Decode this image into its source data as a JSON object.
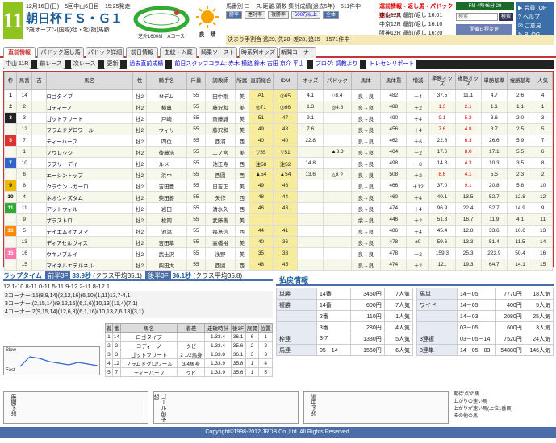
{
  "header": {
    "race_number": "11",
    "date": "12月16日(日)　5回中山6日目　15:25発走",
    "race_name": "朝日杯ＦＳ・Ｇ１",
    "condition": "2歳オープン(国際)牡・牝(指)馬齢",
    "course_label": "芝外1600M　Aコース",
    "weather_label": "良　晴",
    "stats_title": "馬番別 コース.距離.頭数 集計成績(過去5年)　511件中",
    "stats_tabs": [
      "勝率",
      "連対率",
      "複勝率"
    ],
    "stats_link": "500万以上",
    "stats_link2": "全体",
    "quick_links": [
      {
        "name": "運前情報・返し馬・パドック速レース",
        "time": ""
      },
      {
        "name": "中山12R",
        "extra": "運前/返し",
        "time": "16:01"
      },
      {
        "name": "中京12R",
        "extra": "運前/返し",
        "time": "16:10"
      },
      {
        "name": "阪神12R",
        "extra": "運前/返し",
        "time": "16:20"
      }
    ],
    "fm_time": "FM 4時46分 29",
    "search_placeholder": "検索",
    "search_button": "検索",
    "history_button": "開催日程変更",
    "side_menu": [
      "会員TOP",
      "ヘルプ",
      "ご意見",
      "BLOG"
    ],
    "info_bar": "決まり手割合 逃29, 先28, 差28, 追15　1571件中"
  },
  "tabs": [
    "直前情報",
    "パドック返し馬",
    "パドック詳細",
    "前日情報",
    "血統・入厩",
    "騎乗ソースト",
    "時系列オッズ",
    "新聞コーナー"
  ],
  "toolbar": {
    "race_select": "中山 11R",
    "prev": "前レース",
    "next": "次レース",
    "update": "更新",
    "links": [
      "過去直前成績",
      "前日スタッフコラム: 赤木 横路 鈴木 吉田 京介 平山",
      "ブログ: 調教より",
      "トレセンリポート"
    ]
  },
  "columns": [
    "枠",
    "馬番",
    "吉",
    "馬名",
    "性",
    "騎手名",
    "斤量",
    "調教師",
    "所属",
    "直前総合",
    "IDM",
    "オッズ",
    "パドック",
    "馬体",
    "馬体重",
    "増減",
    "単勝オッズ",
    "複勝オッズ",
    "単勝基準",
    "複勝基準",
    "人気"
  ],
  "rows": [
    {
      "waku": "1",
      "ban": "14",
      "name": "ロゴタイプ",
      "sex": "牡2",
      "jockey": "Mデム",
      "kin": "55",
      "trainer": "田中剛",
      "aff": "美",
      "sogo": "A1",
      "idm": "◎65",
      "odds": "4.1",
      "pad": "○8.4",
      "body": "良→良",
      "weight": "482",
      "diff": "－4",
      "tan": "37.5",
      "fuku": "11.1",
      "kt": "4.7",
      "kf": "2.6",
      "pop": "4"
    },
    {
      "waku": "2",
      "ban": "2",
      "name": "コディーノ",
      "sex": "牡2",
      "jockey": "横典",
      "kin": "55",
      "trainer": "藤沢和",
      "aff": "美",
      "sogo": "◎71",
      "idm": "◎66",
      "odds": "1.3",
      "pad": "◎4.8",
      "body": "良→良",
      "weight": "488",
      "diff": "＋2",
      "tan": "1.3",
      "fuku": "2.1",
      "kt": "1.1",
      "kf": "1.1",
      "pop": "1"
    },
    {
      "waku": "3",
      "ban": "3",
      "name": "ゴットフリート",
      "sex": "牡2",
      "jockey": "戸崎",
      "kin": "55",
      "trainer": "斎藤誠",
      "aff": "美",
      "sogo": "51",
      "idm": "47",
      "odds": "9.1",
      "pad": "",
      "body": "良→良",
      "weight": "490",
      "diff": "＋4",
      "tan": "9.1",
      "fuku": "5.3",
      "kt": "3.6",
      "kf": "2.0",
      "pop": "3"
    },
    {
      "waku": "4",
      "ban": "12",
      "name": "フラムドグロワール",
      "sex": "牡2",
      "jockey": "ウィリ",
      "kin": "55",
      "trainer": "藤沢和",
      "aff": "美",
      "sogo": "49",
      "idm": "48",
      "odds": "7.6",
      "pad": "",
      "body": "良→良",
      "weight": "456",
      "diff": "＋4",
      "tan": "7.6",
      "fuku": "4.8",
      "kt": "3.7",
      "kf": "2.5",
      "pop": "5"
    },
    {
      "waku": "5",
      "ban": "7",
      "name": "ティーハーフ",
      "sex": "牡2",
      "jockey": "四位",
      "kin": "55",
      "trainer": "西浦",
      "aff": "西",
      "sogo": "40",
      "idm": "40",
      "odds": "22.8",
      "pad": "",
      "body": "良→良",
      "weight": "462",
      "diff": "＋6",
      "tan": "22.8",
      "fuku": "6.3",
      "kt": "26.6",
      "kf": "5.9",
      "pop": "7"
    },
    {
      "waku": "6",
      "ban": "1",
      "name": "ノウレッジ",
      "sex": "牡2",
      "jockey": "後藤浩",
      "kin": "55",
      "trainer": "二ノ宮",
      "aff": "美",
      "sogo": "▽55",
      "idm": "▽51",
      "odds": "",
      "pad": "▲3.8",
      "body": "良→良",
      "weight": "464",
      "diff": "－2",
      "tan": "17.6",
      "fuku": "8.0",
      "kt": "17.1",
      "kf": "5.5",
      "pop": "6"
    },
    {
      "waku": "7",
      "ban": "10",
      "name": "ラブリーデイ",
      "sex": "牡2",
      "jockey": "ルメー",
      "kin": "55",
      "trainer": "池江寿",
      "aff": "西",
      "sogo": "注58",
      "idm": "注52",
      "odds": "14.8",
      "pad": "",
      "body": "良→良",
      "weight": "498",
      "diff": "－8",
      "tan": "14.8",
      "fuku": "4.3",
      "kt": "10.3",
      "kf": "3.5",
      "pop": "8"
    },
    {
      "waku": "8",
      "ban": "6",
      "name": "エーシントップ",
      "sex": "牡2",
      "jockey": "浜中",
      "kin": "55",
      "trainer": "西園",
      "aff": "西",
      "sogo": "▲54",
      "idm": "▲54",
      "odds": "13.6",
      "pad": "△8.2",
      "body": "良→良",
      "weight": "508",
      "diff": "＋2",
      "tan": "8.6",
      "fuku": "4.1",
      "kt": "5.5",
      "kf": "2.3",
      "pop": "2"
    },
    {
      "waku": "9",
      "ban": "8",
      "name": "クラウンレガーロ",
      "sex": "牡2",
      "jockey": "吉田豊",
      "kin": "55",
      "trainer": "日吉正",
      "aff": "美",
      "sogo": "49",
      "idm": "46",
      "odds": "",
      "pad": "",
      "body": "良→良",
      "weight": "466",
      "diff": "＋12",
      "tan": "37.0",
      "fuku": "9.1",
      "kt": "20.8",
      "kf": "5.8",
      "pop": "10"
    },
    {
      "waku": "10",
      "ban": "4",
      "name": "ネオウィズダム",
      "sex": "牡2",
      "jockey": "柴田善",
      "kin": "55",
      "trainer": "矢作",
      "aff": "西",
      "sogo": "48",
      "idm": "44",
      "odds": "",
      "pad": "",
      "body": "良→良",
      "weight": "460",
      "diff": "＋4",
      "tan": "40.1",
      "fuku": "13.5",
      "kt": "52.7",
      "kf": "12.8",
      "pop": "12"
    },
    {
      "waku": "11",
      "ban": "11",
      "name": "アットウィル",
      "sex": "牡2",
      "jockey": "岩田",
      "kin": "55",
      "trainer": "清水久",
      "aff": "西",
      "sogo": "46",
      "idm": "43",
      "odds": "",
      "pad": "",
      "body": "良→良",
      "weight": "474",
      "diff": "＋4",
      "tan": "96.9",
      "fuku": "22.4",
      "kt": "52.7",
      "kf": "14.9",
      "pop": "9"
    },
    {
      "waku": "12",
      "ban": "9",
      "name": "ザラストロ",
      "sex": "牡2",
      "jockey": "松岡",
      "kin": "55",
      "trainer": "武藤善",
      "aff": "美",
      "sogo": "",
      "idm": "",
      "odds": "",
      "pad": "",
      "body": "余→良",
      "weight": "446",
      "diff": "＋2",
      "tan": "51.3",
      "fuku": "16.7",
      "kt": "11.9",
      "kf": "4.1",
      "pop": "11"
    },
    {
      "waku": "13",
      "ban": "5",
      "name": "テイエムイナズマ",
      "sex": "牡2",
      "jockey": "池添",
      "kin": "55",
      "trainer": "福島信",
      "aff": "西",
      "sogo": "44",
      "idm": "41",
      "odds": "",
      "pad": "",
      "body": "良→良",
      "weight": "486",
      "diff": "＋4",
      "tan": "45.4",
      "fuku": "12.8",
      "kt": "33.6",
      "kf": "10.6",
      "pop": "13"
    },
    {
      "waku": "14",
      "ban": "13",
      "name": "ディアセルヴィス",
      "sex": "牡2",
      "jockey": "吉田隼",
      "kin": "55",
      "trainer": "高橋裕",
      "aff": "美",
      "sogo": "40",
      "idm": "36",
      "odds": "",
      "pad": "",
      "body": "良→良",
      "weight": "478",
      "diff": "±0",
      "tan": "59.6",
      "fuku": "13.3",
      "kt": "51.4",
      "kf": "11.5",
      "pop": "14"
    },
    {
      "waku": "15",
      "ban": "16",
      "name": "ウキノプルイ",
      "sex": "牡2",
      "jockey": "武士沢",
      "kin": "55",
      "trainer": "浅野",
      "aff": "美",
      "sogo": "35",
      "idm": "33",
      "odds": "",
      "pad": "",
      "body": "良→良",
      "weight": "478",
      "diff": "－2",
      "tan": "159.3",
      "fuku": "25.3",
      "kt": "223.9",
      "kf": "50.4",
      "pop": "16"
    },
    {
      "waku": "16",
      "ban": "15",
      "name": "マイネルエテルネル",
      "sex": "牡2",
      "jockey": "柴田大",
      "kin": "55",
      "trainer": "西園",
      "aff": "西",
      "sogo": "48",
      "idm": "45",
      "odds": "",
      "pad": "",
      "body": "良→良",
      "weight": "474",
      "diff": "＋2",
      "tan": "121",
      "fuku": "19.3",
      "kt": "64.7",
      "kf": "14.1",
      "pop": "15"
    }
  ],
  "lap": {
    "title": "ラップタイム",
    "first_label": "前半3F",
    "first_val": "33.9秒",
    "first_avg": "(クラス平均35.1)",
    "last_label": "後半3F",
    "last_val": "36.1秒",
    "last_avg": "(クラス平均35.8)",
    "laps": "12.1-10.8-11.0-11.5-11.9-12.2-11.8-12.1",
    "corners": [
      "2コーナー:15(8,9,14)(2,12,16)(6,10)(1,11)13,7-4,1",
      "3コーナー:(2,15,14)(9,12,16)(6,1,6)(10,13)(11,4)(7,1)",
      "4コーナー:2(9,15,14)(12,6,8)(6,1,16)(10,13,7,6,13)(3,1)"
    ],
    "pace_label": "Slow",
    "pace_label2": "Fast"
  },
  "results": {
    "headers": [
      "着",
      "番",
      "馬名",
      "着差",
      "走破時計",
      "後3F",
      "展開",
      "位置"
    ],
    "rows": [
      [
        "1",
        "14",
        "ロゴタイプ",
        "",
        "1.33.4",
        "36.1",
        "6",
        "1"
      ],
      [
        "2",
        "2",
        "コディーノ",
        "クビ",
        "1.33.4",
        "35.6",
        "2",
        "2"
      ],
      [
        "3",
        "3",
        "ゴットフリート",
        "2 1/2馬身",
        "1.33.8",
        "36.1",
        "3",
        "3"
      ],
      [
        "4",
        "12",
        "フラムドグロワール",
        "3/4馬身",
        "1.33.9",
        "35.8",
        "1",
        "4"
      ],
      [
        "5",
        "7",
        "ティーハーフ",
        "クビ",
        "1.33.9",
        "35.6",
        "1",
        "5"
      ]
    ]
  },
  "payout": {
    "title": "払戻情報",
    "left": [
      {
        "label": "単勝",
        "combo": "14番",
        "amount": "3450円",
        "pop": "7人気"
      },
      {
        "label": "複勝",
        "combo": "14番",
        "amount": "600円",
        "pop": "7人気"
      },
      {
        "label": "",
        "combo": "2番",
        "amount": "110円",
        "pop": "1人気"
      },
      {
        "label": "",
        "combo": "3番",
        "amount": "280円",
        "pop": "4人気"
      },
      {
        "label": "枠連",
        "combo": "3-7",
        "amount": "1380円",
        "pop": "5人気"
      },
      {
        "label": "馬連",
        "combo": "05－14",
        "amount": "1560円",
        "pop": "6人気"
      }
    ],
    "right": [
      {
        "label": "馬単",
        "combo": "14－05",
        "amount": "7770円",
        "pop": "18人気"
      },
      {
        "label": "ワイド",
        "combo": "14－05",
        "amount": "400円",
        "pop": "5人気"
      },
      {
        "label": "",
        "combo": "14－03",
        "amount": "2080円",
        "pop": "25人気"
      },
      {
        "label": "",
        "combo": "03－05",
        "amount": "600円",
        "pop": "3人気"
      },
      {
        "label": "3連複",
        "combo": "03－05－14",
        "amount": "7520円",
        "pop": "24人気"
      },
      {
        "label": "3連単",
        "combo": "14－05－03",
        "amount": "54880円",
        "pop": "146人気"
      }
    ]
  },
  "bottom": {
    "box1": "展開予想",
    "box2": "ゴール前予想",
    "box3": "道中予想",
    "legend": [
      "期待'点'の馬",
      "上がりの速い馬",
      "上がりが速い馬(上位1番目)",
      "その他の馬"
    ]
  },
  "footer": "Copyright©1998-2012 JRDB Co.,Ltd. All Rights Reserved."
}
